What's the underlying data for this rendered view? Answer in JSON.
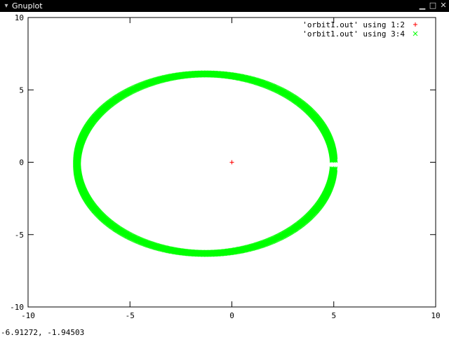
{
  "window": {
    "title": "Gnuplot",
    "menu_icon": "chevron-down-icon",
    "controls": [
      "minimize-icon",
      "maximize-icon",
      "close-icon"
    ]
  },
  "status": {
    "mouse_coordinates": "-6.91272, -1.94503"
  },
  "colors": {
    "series1": "#ff0000",
    "series2": "#00ff00"
  },
  "chart_data": {
    "type": "scatter",
    "title": "",
    "xlabel": "",
    "ylabel": "",
    "xlim": [
      -10,
      10
    ],
    "ylim": [
      -10,
      10
    ],
    "x_ticks": [
      "-10",
      "-5",
      "0",
      "5",
      "10"
    ],
    "y_ticks": [
      "-10",
      "-5",
      "0",
      "5",
      "10"
    ],
    "grid": false,
    "legend_position": "top-right",
    "series": [
      {
        "name": "'orbit1.out' using 1:2",
        "marker": "+",
        "color": "#ff0000",
        "points": [
          [
            0,
            0
          ]
        ]
      },
      {
        "name": "'orbit1.out' using 3:4",
        "marker": "x",
        "color": "#00ff00",
        "description": "elliptical orbit",
        "ellipse": {
          "cx": -1.3,
          "cy": -0.1,
          "rx": 6.3,
          "ry": 6.2
        },
        "gap_near": [
          5.0,
          -0.2
        ]
      }
    ]
  }
}
